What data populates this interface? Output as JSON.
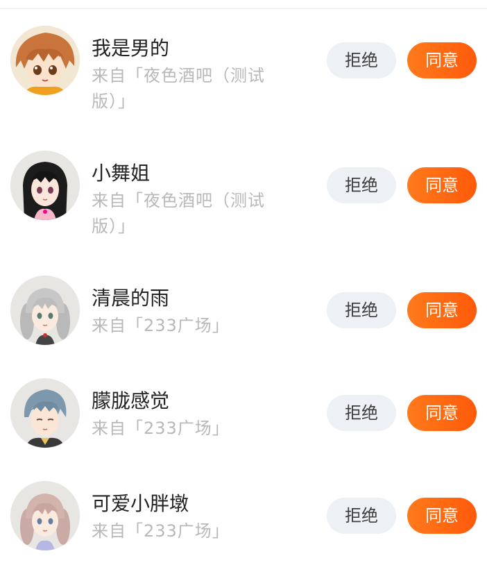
{
  "requests": [
    {
      "name": "我是男的",
      "source": "来自「夜色酒吧（测试版）」",
      "avatar_icon": "avatar-anime-boy-orange-hair",
      "reject_label": "拒绝",
      "accept_label": "同意"
    },
    {
      "name": "小舞姐",
      "source": "来自「夜色酒吧（测试版）」",
      "avatar_icon": "avatar-anime-girl-black-hair",
      "reject_label": "拒绝",
      "accept_label": "同意"
    },
    {
      "name": "清晨的雨",
      "source": "来自「233广场」",
      "avatar_icon": "avatar-anime-girl-silver-hair",
      "reject_label": "拒绝",
      "accept_label": "同意"
    },
    {
      "name": "朦胧感觉",
      "source": "来自「233广场」",
      "avatar_icon": "avatar-anime-boy-blue-hair",
      "reject_label": "拒绝",
      "accept_label": "同意"
    },
    {
      "name": "可爱小胖墩",
      "source": "来自「233广场」",
      "avatar_icon": "avatar-anime-girl-pink-hair",
      "reject_label": "拒绝",
      "accept_label": "同意"
    }
  ],
  "colors": {
    "accept_gradient_start": "#ff7a1c",
    "accept_gradient_end": "#ff5a0a",
    "reject_bg": "#edf0f4",
    "source_text": "#b8b8b8",
    "name_text": "#222222"
  }
}
